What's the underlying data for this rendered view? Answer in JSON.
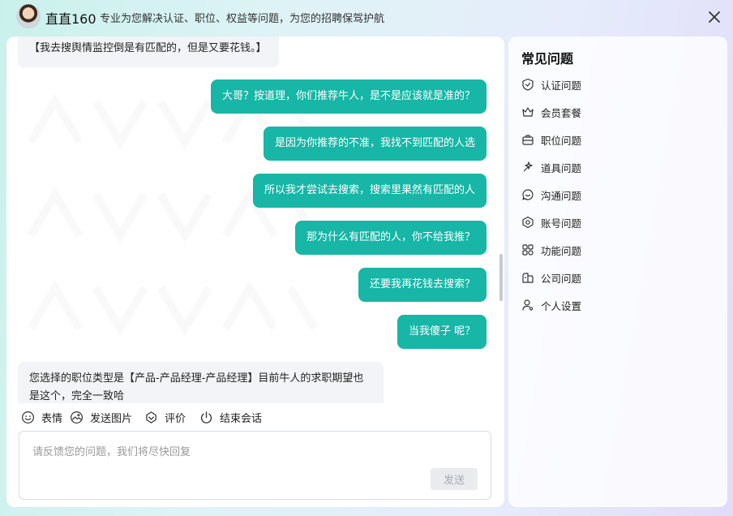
{
  "header": {
    "brand": "直直160",
    "slogan": "专业为您解决认证、职位、权益等问题，为您的招聘保驾护航",
    "close_icon": "close-icon"
  },
  "chat": {
    "messages": [
      {
        "side": "in",
        "text": "【我去搜舆情监控倒是有匹配的，但是又要花钱。】"
      },
      {
        "side": "out",
        "text": "大哥？按道理，你们推荐牛人，是不是应该就是准的？"
      },
      {
        "side": "out",
        "text": "是因为你推荐的不准，我找不到匹配的人选"
      },
      {
        "side": "out",
        "text": "所以我才尝试去搜索，搜索里果然有匹配的人"
      },
      {
        "side": "out",
        "text": "那为什么有匹配的人，你不给我推？"
      },
      {
        "side": "out",
        "text": "还要我再花钱去搜索？"
      },
      {
        "side": "out",
        "text": "当我傻子 呢？"
      },
      {
        "side": "in",
        "text": "您选择的职位类型是【产品-产品经理-产品经理】目前牛人的求职期望也是这个，完全一致哈"
      }
    ],
    "colors": {
      "outgoing": "#17b6a6",
      "incoming": "#f2f4f7"
    }
  },
  "toolbar": {
    "emoji": {
      "label": "表情",
      "icon": "smile-icon"
    },
    "image": {
      "label": "发送图片",
      "icon": "image-icon"
    },
    "rate": {
      "label": "评价",
      "icon": "rate-icon"
    },
    "end": {
      "label": "结束会话",
      "icon": "power-icon"
    }
  },
  "input": {
    "placeholder": "请反馈您的问题，我们将尽快回复",
    "value": "",
    "send_label": "发送"
  },
  "faq": {
    "title": "常见问题",
    "items": [
      {
        "label": "认证问题",
        "icon": "shield-check-icon"
      },
      {
        "label": "会员套餐",
        "icon": "crown-icon"
      },
      {
        "label": "职位问题",
        "icon": "briefcase-icon"
      },
      {
        "label": "道具问题",
        "icon": "magic-wand-icon"
      },
      {
        "label": "沟通问题",
        "icon": "chat-bubble-icon"
      },
      {
        "label": "账号问题",
        "icon": "account-hexagon-icon"
      },
      {
        "label": "功能问题",
        "icon": "grid-apps-icon"
      },
      {
        "label": "公司问题",
        "icon": "building-icon"
      },
      {
        "label": "个人设置",
        "icon": "user-settings-icon"
      }
    ]
  }
}
